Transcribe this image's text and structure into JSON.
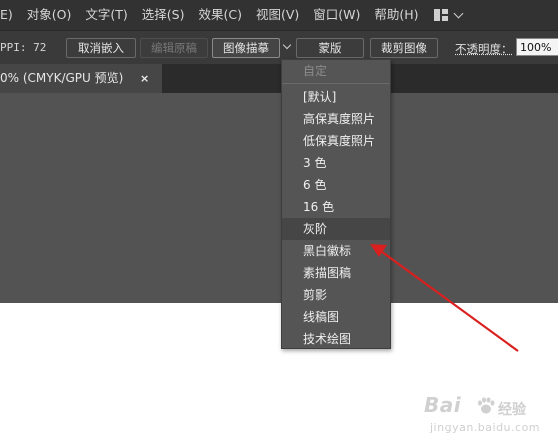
{
  "menubar": {
    "items": [
      "E)",
      "对象(O)",
      "文字(T)",
      "选择(S)",
      "效果(C)",
      "视图(V)",
      "窗口(W)",
      "帮助(H)"
    ]
  },
  "control": {
    "ppi_label": "PPI: 72",
    "embed_button": "取消嵌入",
    "edit_original_button": "编辑原稿",
    "trace_button": "图像描摹",
    "mask_button": "蒙版",
    "crop_button": "裁剪图像",
    "opacity_label": "不透明度：",
    "opacity_value": "100%"
  },
  "tab": {
    "title": "0% (CMYK/GPU 预览)",
    "close": "×"
  },
  "dropdown": {
    "items": [
      {
        "label": "自定",
        "disabled": true
      },
      {
        "label": "[默认]"
      },
      {
        "label": "高保真度照片"
      },
      {
        "label": "低保真度照片"
      },
      {
        "label": "3 色"
      },
      {
        "label": "6 色"
      },
      {
        "label": "16 色"
      },
      {
        "label": "灰阶",
        "highlighted": true
      },
      {
        "label": "黑白徽标"
      },
      {
        "label": "素描图稿"
      },
      {
        "label": "剪影"
      },
      {
        "label": "线稿图"
      },
      {
        "label": "技术绘图"
      }
    ]
  },
  "annotation": {
    "arrow_color": "#d9201e"
  },
  "watermark": {
    "logo": "Bai",
    "suffix": "经验",
    "url": "jingyan.baidu.com"
  }
}
